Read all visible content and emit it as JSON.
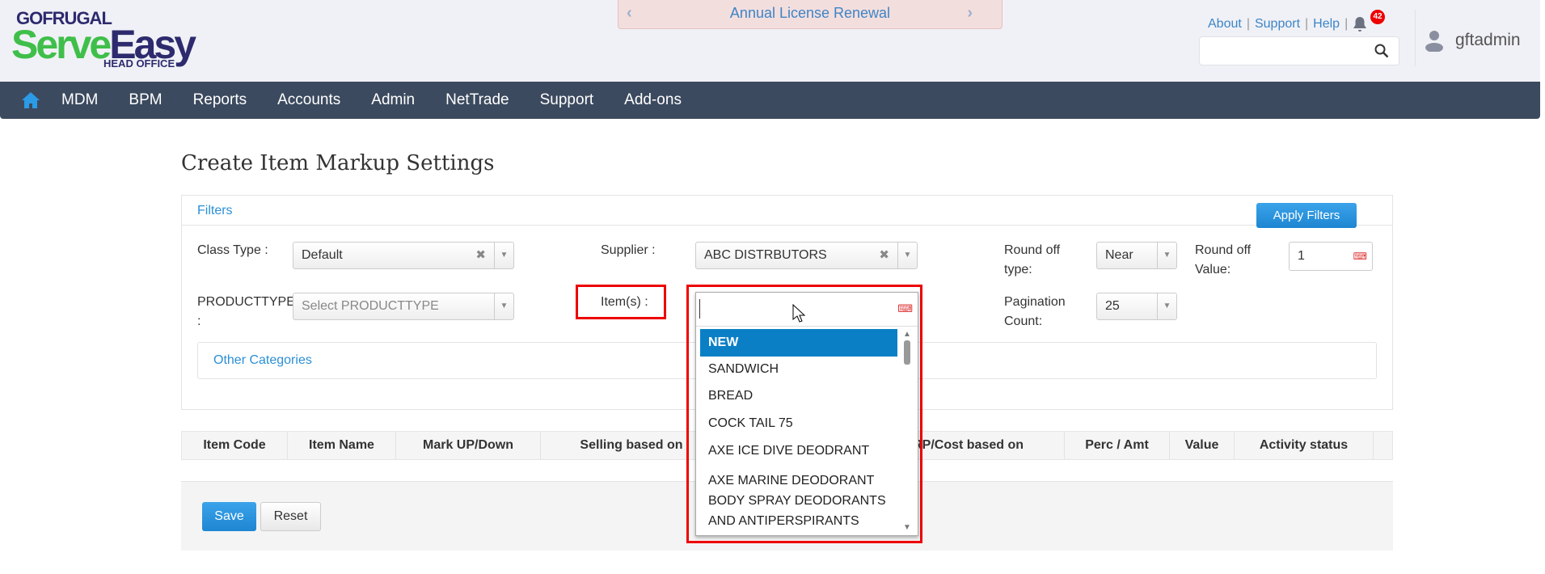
{
  "header": {
    "logo_top": "GOFRUGAL",
    "logo_main_a": "Serve",
    "logo_main_b": "Easy",
    "logo_sub": "HEAD OFFICE",
    "banner": "Annual License Renewal",
    "links": [
      "About",
      "Support",
      "Help"
    ],
    "notification_count": "42",
    "username": "gftadmin",
    "search_placeholder": ""
  },
  "nav": [
    "MDM",
    "BPM",
    "Reports",
    "Accounts",
    "Admin",
    "NetTrade",
    "Support",
    "Add-ons"
  ],
  "page_title": "Create Item Markup Settings",
  "filters": {
    "title": "Filters",
    "apply_label": "Apply Filters",
    "class_type_label": "Class Type :",
    "class_type_value": "Default",
    "supplier_label": "Supplier :",
    "supplier_value": "ABC DISTRBUTORS",
    "round_off_type_label_1": "Round off",
    "round_off_type_label_2": "type:",
    "round_off_type_value": "Near",
    "round_off_value_label_1": "Round off",
    "round_off_value_label_2": "Value:",
    "round_off_value": "1",
    "producttype_label": "PRODUCTTYPE",
    "producttype_colon": ":",
    "producttype_placeholder": "Select PRODUCTTYPE",
    "items_label": "Item(s) :",
    "pagination_label_1": "Pagination",
    "pagination_label_2": "Count:",
    "pagination_value": "25",
    "other_categories": "Other Categories"
  },
  "dropdown": {
    "options": [
      "NEW",
      "SANDWICH",
      "BREAD",
      "COCK TAIL 75",
      "AXE ICE DIVE DEODRANT",
      "AXE MARINE DEODORANT",
      "BODY SPRAY DEODORANTS",
      "AND ANTIPERSPIRANTS"
    ]
  },
  "table": {
    "headers": [
      "Item Code",
      "Item Name",
      "Mark UP/Down",
      "Selling based on",
      "MRP/Cost based on",
      "Perc / Amt",
      "Value",
      "Activity status"
    ]
  },
  "footer": {
    "save": "Save",
    "reset": "Reset"
  },
  "colors": {
    "nav": "#3c4a5f",
    "accent": "#2b8fd6",
    "highlight": "#e00000"
  }
}
